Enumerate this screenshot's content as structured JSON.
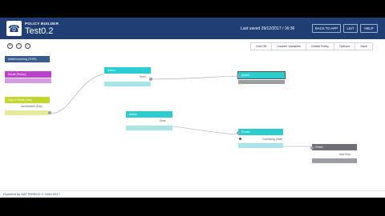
{
  "header": {
    "logo_icon": "phone-icon",
    "app_label": "POLICY BUILDER",
    "title": "Test0.2",
    "last_saved": "Last saved 29/12/2017 / 16:36",
    "buttons": {
      "back": "BACK TO APP",
      "list": "LIST",
      "help": "HELP"
    }
  },
  "zoom": {
    "in": "+",
    "out": "−",
    "fit": "□"
  },
  "toolbar": {
    "grid": "Grid Off",
    "custom": "Custom Variables",
    "global": "Global Policy",
    "options": "Options",
    "save": "Save"
  },
  "nodes": {
    "start": "Initial Incoming (THIS)",
    "route": "Route (Policy)",
    "day": "Day of Week (Day)",
    "day_port": "not between (Day)",
    "action1": "Action",
    "action1_port": "Done",
    "action2": "Action",
    "action2_port": "Done",
    "action3": "Action",
    "action3_port": "Continuing (hold)",
    "router": "Router",
    "finish": "Finish",
    "finish_port": "next Step"
  },
  "footer": {
    "text": "Powered by NATTERBOX © 2009-2017"
  },
  "colors": {
    "header": "#1e3e74",
    "teal": "#2bcdd0",
    "magenta": "#c03fcf",
    "lime": "#c4d62a",
    "gray": "#9a9da3"
  }
}
